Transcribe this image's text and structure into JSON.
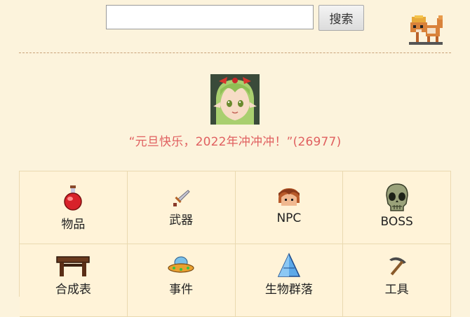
{
  "search": {
    "placeholder": "",
    "value": "",
    "button_label": "搜索"
  },
  "quote": {
    "text": "“元旦快乐，2022年冲冲冲！”(26977)"
  },
  "categories": [
    {
      "label": "物品",
      "icon": "potion-icon"
    },
    {
      "label": "武器",
      "icon": "sword-icon"
    },
    {
      "label": "NPC",
      "icon": "npc-head-icon"
    },
    {
      "label": "BOSS",
      "icon": "skull-icon"
    },
    {
      "label": "合成表",
      "icon": "workbench-icon"
    },
    {
      "label": "事件",
      "icon": "ufo-icon"
    },
    {
      "label": "生物群落",
      "icon": "crystal-icon"
    },
    {
      "label": "工具",
      "icon": "pickaxe-icon"
    }
  ],
  "colors": {
    "background": "#fcf3dc",
    "quote": "#e06060",
    "divider": "#c9a27a"
  }
}
